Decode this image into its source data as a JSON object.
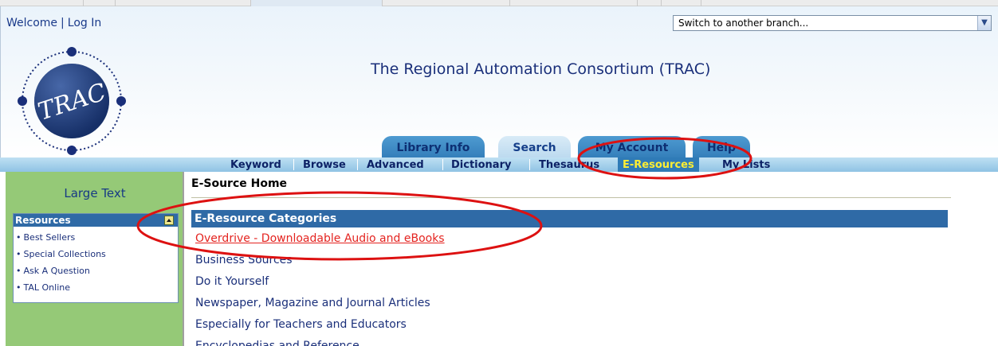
{
  "header": {
    "welcome_label": "Welcome",
    "login_label": "Log In",
    "branch_select_value": "Switch to another branch...",
    "site_title": "The Regional Automation Consortium (TRAC)",
    "logo_text": "TRAC"
  },
  "tabs": [
    {
      "label": "Library Info"
    },
    {
      "label": "Search"
    },
    {
      "label": "My Account"
    },
    {
      "label": "Help"
    }
  ],
  "subnav": [
    {
      "label": "Keyword"
    },
    {
      "label": "Browse"
    },
    {
      "label": "Advanced"
    },
    {
      "label": "Dictionary"
    },
    {
      "label": "Thesaurus"
    },
    {
      "label": "E-Resources",
      "active": true
    },
    {
      "label": "My Lists"
    }
  ],
  "sidebar": {
    "large_text_label": "Large Text",
    "resources_header": "Resources",
    "items": [
      {
        "label": "Best Sellers"
      },
      {
        "label": "Special Collections"
      },
      {
        "label": "Ask A Question"
      },
      {
        "label": "TAL Online"
      }
    ]
  },
  "main": {
    "page_title": "E-Source Home",
    "categories_header": "E-Resource Categories",
    "categories": [
      {
        "label": "Overdrive - Downloadable Audio and eBooks"
      },
      {
        "label": "Business Sources"
      },
      {
        "label": "Do it Yourself"
      },
      {
        "label": "Newspaper, Magazine and Journal Articles"
      },
      {
        "label": "Especially for Teachers and Educators"
      },
      {
        "label": "Encyclopedias and Reference"
      }
    ]
  },
  "colors": {
    "brand_blue": "#2f6aa6",
    "active_tab_text": "#ffee33",
    "sidebar_green": "#95c977",
    "annotation_red": "#dd1111"
  }
}
